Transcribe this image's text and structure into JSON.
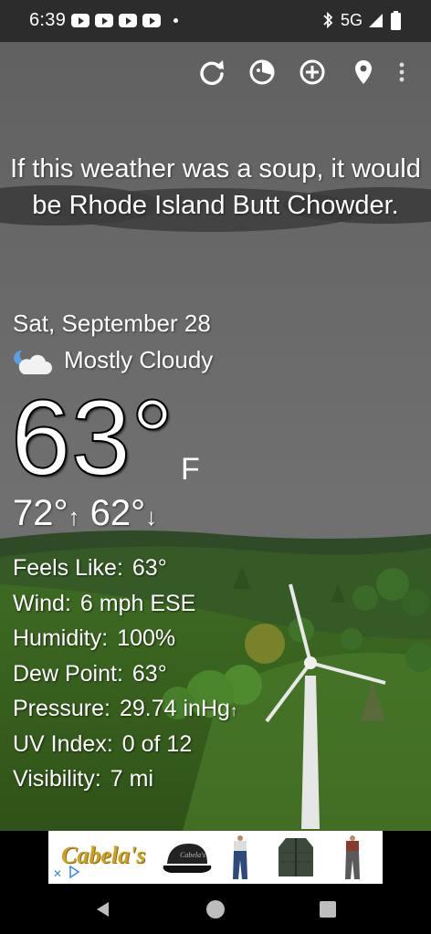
{
  "status_bar": {
    "time": "6:39",
    "network": "5G"
  },
  "toolbar": {
    "icons": [
      "refresh-icon",
      "radar-icon",
      "add-location-icon",
      "location-pin-icon",
      "overflow-menu-icon"
    ]
  },
  "weather": {
    "headline": "If this weather was a soup, it would be Rhode Island Butt Chowder.",
    "date": "Sat, September 28",
    "condition": "Mostly Cloudy",
    "temperature": "63°",
    "unit": "F",
    "high": "72°",
    "low": "62°",
    "details": [
      {
        "label": "Feels Like:",
        "value": "63°"
      },
      {
        "label": "Wind:",
        "value": "6 mph ESE"
      },
      {
        "label": "Humidity:",
        "value": "100%"
      },
      {
        "label": "Dew Point:",
        "value": "63°"
      },
      {
        "label": "Pressure:",
        "value": "29.74 inHg"
      },
      {
        "label": "UV Index:",
        "value": "0 of 12"
      },
      {
        "label": "Visibility:",
        "value": "7 mi"
      }
    ]
  },
  "ad": {
    "brand": "Cabela's"
  },
  "colors": {
    "sky": "#6b6b6b",
    "grass": "#3f6a24",
    "ad_gold": "#c9a227"
  }
}
